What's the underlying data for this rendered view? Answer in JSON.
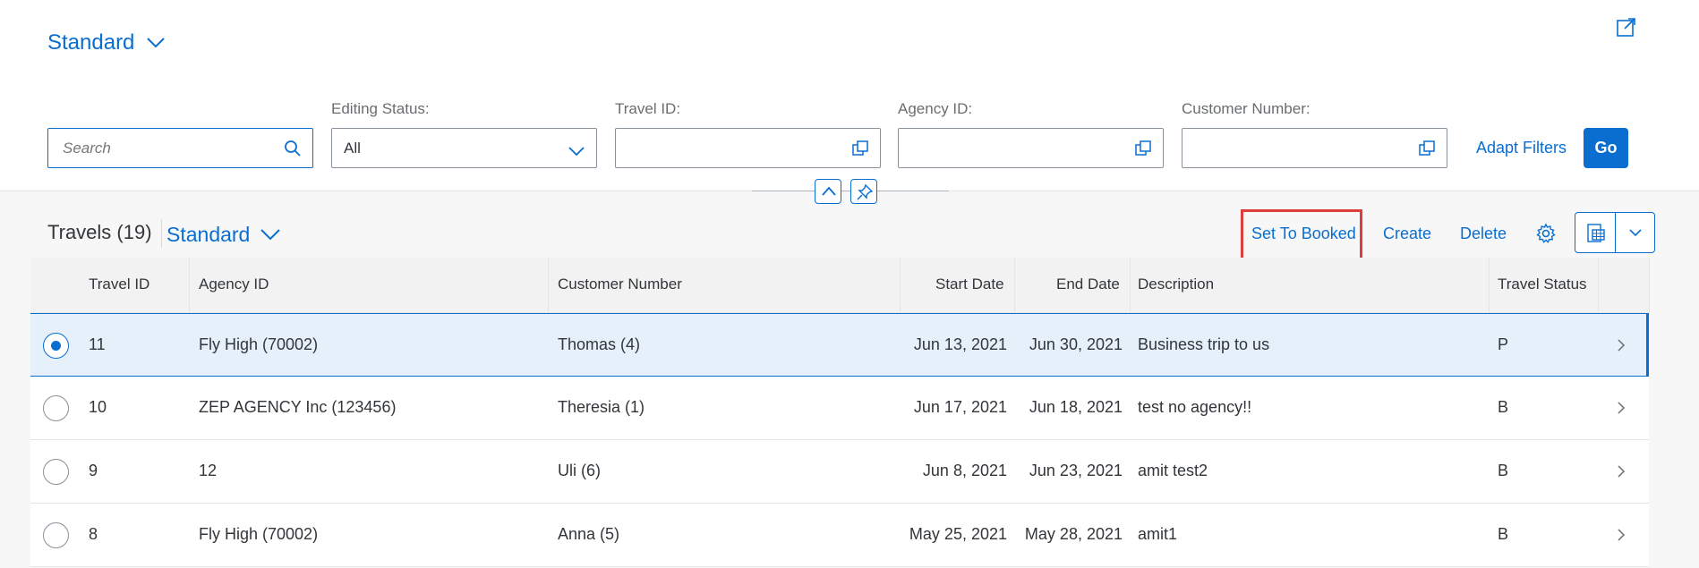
{
  "header": {
    "variant_name": "Standard",
    "search": {
      "placeholder": "Search"
    },
    "filters": [
      {
        "label": "Editing Status:",
        "value": "All"
      },
      {
        "label": "Travel ID:",
        "value": ""
      },
      {
        "label": "Agency ID:",
        "value": ""
      },
      {
        "label": "Customer Number:",
        "value": ""
      }
    ],
    "adapt_filters_label": "Adapt Filters",
    "go_label": "Go"
  },
  "table": {
    "title": "Travels (19)",
    "variant_name": "Standard",
    "toolbar": {
      "set_to_booked": "Set To Booked",
      "create": "Create",
      "delete": "Delete"
    },
    "columns": [
      "Travel ID",
      "Agency ID",
      "Customer Number",
      "Start Date",
      "End Date",
      "Description",
      "Travel Status"
    ],
    "rows": [
      {
        "travel_id": "11",
        "agency": "Fly High (70002)",
        "customer": "Thomas (4)",
        "start": "Jun 13, 2021",
        "end": "Jun 30, 2021",
        "description": "Business trip to us",
        "status": "P",
        "selected": true
      },
      {
        "travel_id": "10",
        "agency": "ZEP AGENCY Inc (123456)",
        "customer": "Theresia (1)",
        "start": "Jun 17, 2021",
        "end": "Jun 18, 2021",
        "description": "test no agency!!",
        "status": "B",
        "selected": false
      },
      {
        "travel_id": "9",
        "agency": "12",
        "customer": "Uli (6)",
        "start": "Jun 8, 2021",
        "end": "Jun 23, 2021",
        "description": "amit test2",
        "status": "B",
        "selected": false
      },
      {
        "travel_id": "8",
        "agency": "Fly High (70002)",
        "customer": "Anna (5)",
        "start": "May 25, 2021",
        "end": "May 28, 2021",
        "description": "amit1",
        "status": "B",
        "selected": false
      }
    ]
  },
  "colors": {
    "accent": "#0a6ed1",
    "highlight": "#e03c3c",
    "selected_row": "#e5f0fa"
  },
  "icons": [
    "share-icon",
    "chevron-down-icon",
    "search-icon",
    "value-help-icon",
    "collapse-up-icon",
    "pin-icon",
    "settings-icon",
    "export-spreadsheet-icon",
    "row-navigation-icon"
  ]
}
